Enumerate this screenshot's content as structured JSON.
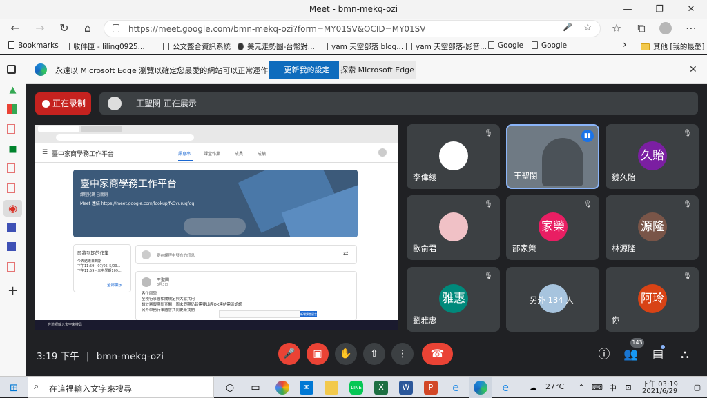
{
  "window": {
    "title": "Meet - bmn-mekq-ozi",
    "min": "—",
    "restore": "❐",
    "close": "✕"
  },
  "address": {
    "url": "https://meet.google.com/bmn-mekq-ozi?form=MY01SV&OCID=MY01SV",
    "back": "←",
    "forward": "→",
    "reload": "↻",
    "home": "⌂",
    "mic": "🎤",
    "star": "☆",
    "favorites": "☆",
    "collections": "⧉",
    "more": "⋯"
  },
  "bookmarks": {
    "items": [
      "Bookmarks",
      "收件匣 - liling0925...",
      "公文整合資訊系統",
      "美元走勢圖-台幣對...",
      "yam 天空部落 blog...",
      "yam 天空部落-影音...",
      "Google",
      "Google"
    ],
    "overflow": "›",
    "other": "其他 [我的最愛]"
  },
  "banner": {
    "message": "永遠以 Microsoft Edge 瀏覽以確定您最愛的網站可以正常運作",
    "update_button": "更新我的設定",
    "explore_button": "探索 Microsoft Edge",
    "close": "✕"
  },
  "meet": {
    "recording_label": "正在录制",
    "presenting_text": "王聖閔 正在展示",
    "shared_screen": {
      "class_title": "臺中家商學務工作平台",
      "tabs": [
        "訊息串",
        "課堂作業",
        "成員",
        "成績"
      ],
      "hero_title": "臺中家商學務工作平台",
      "class_code": "課程代碼  已關閉",
      "meet_link": "Meet 連結  https://meet.google.com/lookup/fx3vuruqfdg",
      "upcoming_title": "即將到期的作業",
      "upcoming_lines": [
        "今天結束日到期",
        "下午11:59 - 07/05_5/09...",
        "下午11:59 - 三中學期109..."
      ],
      "view_all": "全部顯示",
      "share_placeholder": "要在課程中發布的訊息",
      "post_author": "王聖閔",
      "post_date": "3月3日",
      "post_lines": [
        "各位同學",
        "全校行事曆相關規定與大家共用",
        "請於寒假期間查閱，周末假期仍皆需要出席OK連結需確認認",
        "另外學務行事曆會共同更新我們"
      ],
      "reply_button": "新增課堂留言",
      "taskbar_text": "在這裡輸入文字來搜尋"
    },
    "participants": [
      {
        "name": "李偉綾",
        "avatar_text": "",
        "avatar_color": "#ffffff",
        "muted": true
      },
      {
        "name": "王聖閔",
        "avatar_text": "",
        "avatar_color": "#6f7a84",
        "muted": false,
        "speaking": true
      },
      {
        "name": "魏久貽",
        "avatar_text": "久貽",
        "avatar_color": "#7b1fa2",
        "muted": true
      },
      {
        "name": "歐俞君",
        "avatar_text": "",
        "avatar_color": "#f0c1c6",
        "muted": true
      },
      {
        "name": "邵家榮",
        "avatar_text": "家榮",
        "avatar_color": "#e91e63",
        "muted": true
      },
      {
        "name": "林源隆",
        "avatar_text": "源隆",
        "avatar_color": "#795548",
        "muted": true
      },
      {
        "name": "劉雅惠",
        "avatar_text": "雅惠",
        "avatar_color": "#00897b",
        "muted": true
      },
      {
        "name": "另外 134 人",
        "avatar_text": "",
        "avatar_color": "#a7c4de",
        "muted": false
      },
      {
        "name": "你",
        "avatar_text": "阿玲",
        "avatar_color": "#d84315",
        "muted": true
      }
    ],
    "clock": "3:19 下午",
    "separator": "|",
    "meeting_code": "bmn-mekq-ozi",
    "participant_count": "143"
  },
  "taskbar": {
    "search_placeholder": "在這裡輸入文字來搜尋",
    "weather": "27°C",
    "ime": "中",
    "time": "下午 03:19",
    "date": "2021/6/29"
  }
}
